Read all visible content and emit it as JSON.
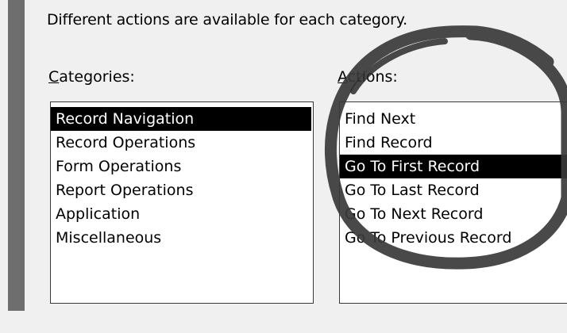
{
  "dialog": {
    "description": "Different actions are available for each category."
  },
  "categories": {
    "label_accel": "C",
    "label_rest": "ategories:",
    "items": [
      "Record Navigation",
      "Record Operations",
      "Form Operations",
      "Report Operations",
      "Application",
      "Miscellaneous"
    ],
    "selected_index": 0
  },
  "actions": {
    "label_accel": "A",
    "label_rest": "ctions:",
    "items": [
      "Find Next",
      "Find Record",
      "Go To First Record",
      "Go To Last Record",
      "Go To Next Record",
      "Go To Previous Record"
    ],
    "selected_index": 2
  },
  "colors": {
    "selection_bg": "#000000",
    "selection_fg": "#ffffff",
    "marker": "#3a3a3a"
  }
}
